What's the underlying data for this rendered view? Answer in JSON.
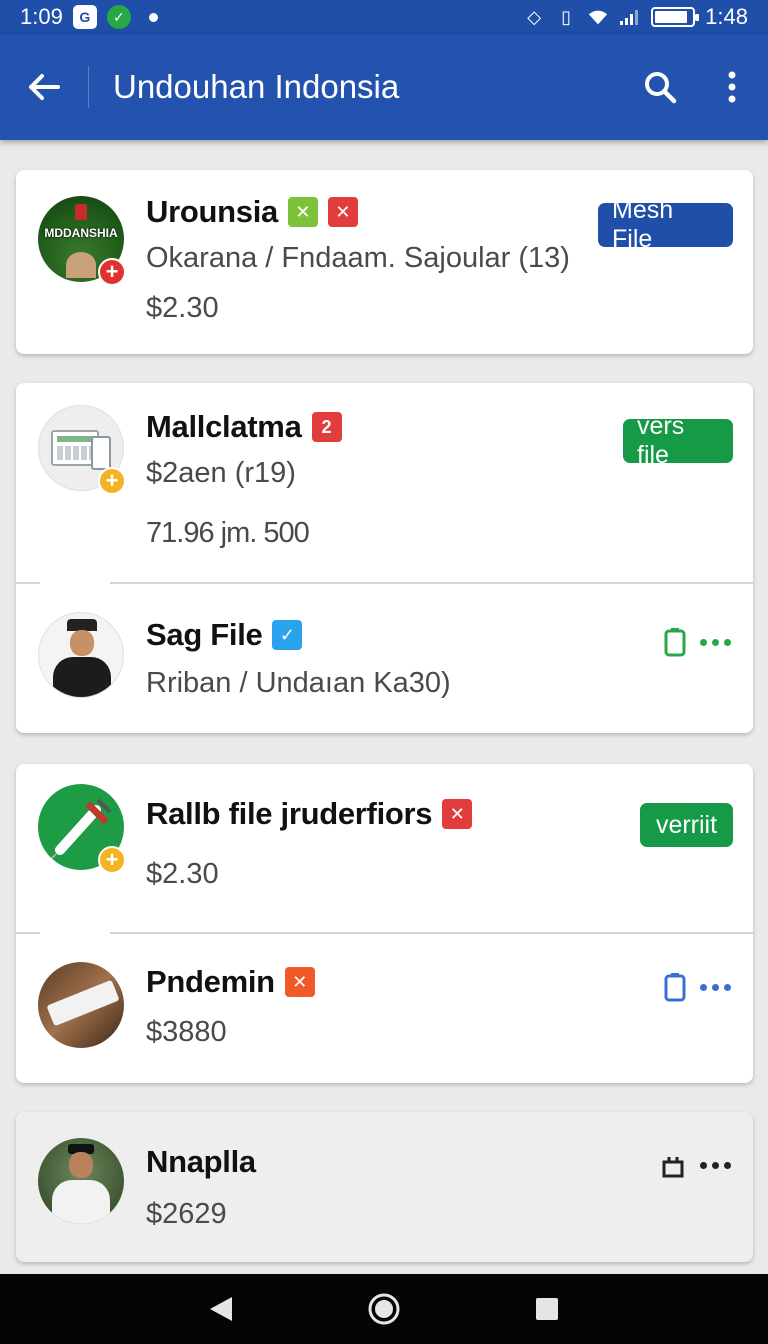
{
  "status_bar": {
    "time_left": "1:09",
    "time_right": "1:48",
    "battery_level": 0.9
  },
  "app_bar": {
    "title": "Undouhan Indonsia"
  },
  "avatar_text": "MDDANSHIA",
  "items": [
    {
      "title": "Urounsia",
      "line1": "Okarana / Fndaam. Sajoular (13)",
      "line2": "$2.30",
      "pill": "Mesh File",
      "badge_color": "#1f4fa8"
    },
    {
      "title": "Mallclatma",
      "count_badge": "2",
      "line1": "$2aen (r19)",
      "line2": "71.96 jm. 500",
      "pill": "vers file",
      "badge_color": "#169a47"
    },
    {
      "title": "Sag File",
      "line1": "Rriban / Undaıan Ka30)",
      "accent": "#27a846"
    },
    {
      "title": "Rallb file jruderfiors",
      "line1": "$2.30",
      "pill": "verriit",
      "badge_color": "#169a47"
    },
    {
      "title": "Pndemin",
      "line1": "$3880",
      "accent": "#3a6fd1"
    },
    {
      "title": "Nnaplla",
      "line1": "$2629",
      "accent": "#222222"
    }
  ]
}
